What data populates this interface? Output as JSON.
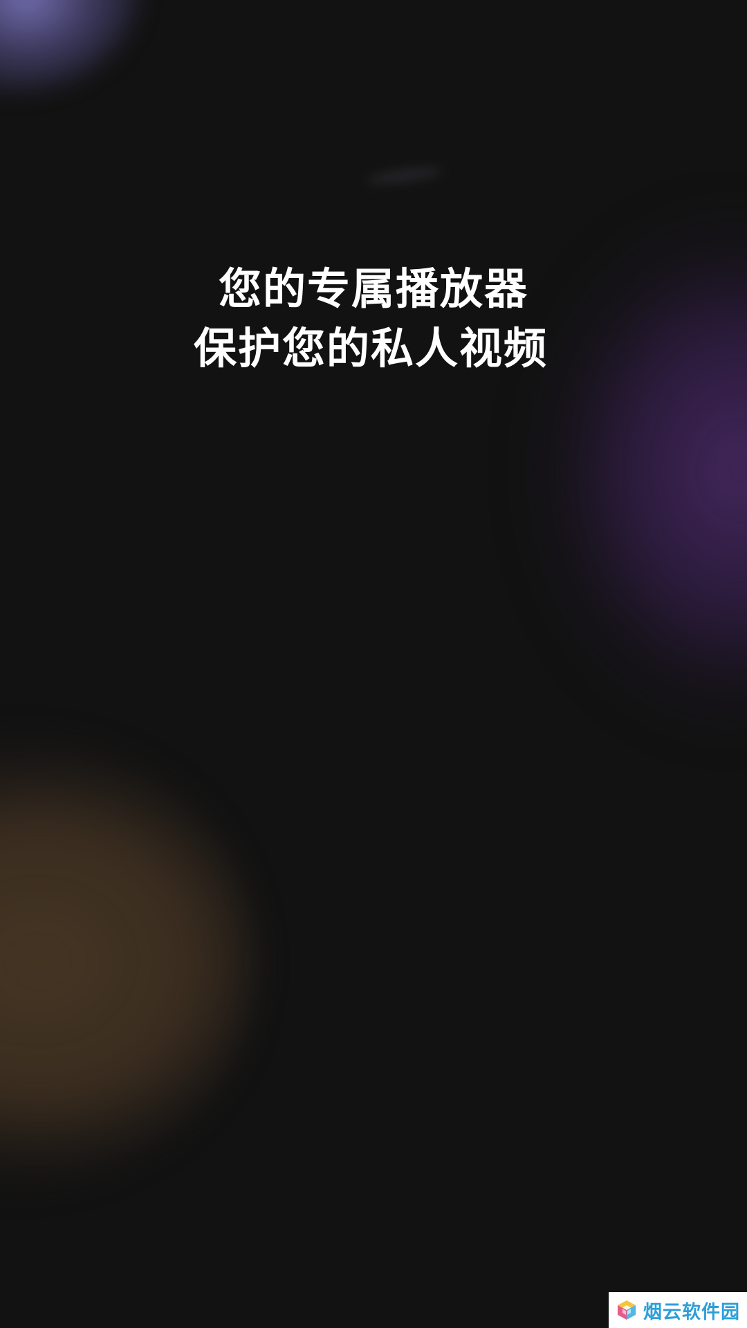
{
  "headline": {
    "line1": "您的专属播放器",
    "line2": "保护您的私人视频"
  },
  "watermark": {
    "text": "烟云软件园",
    "icon": "colorful-cube-icon",
    "text_color": "#2d9fd8"
  },
  "colors": {
    "background": "#121212",
    "glow_topleft": "#7a76bc",
    "glow_right": "#462860",
    "glow_bottomleft": "#463624",
    "headline": "#ffffff"
  }
}
